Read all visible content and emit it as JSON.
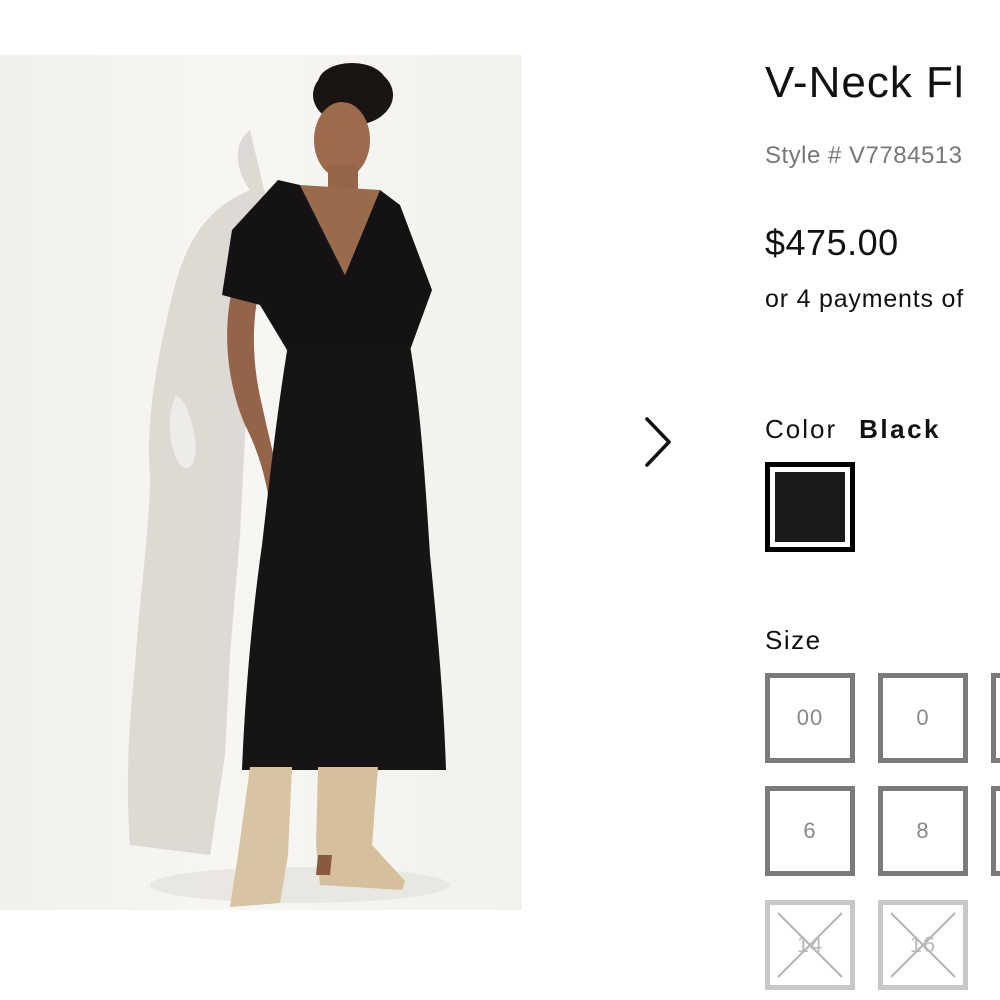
{
  "product": {
    "title": "V-Neck Fl",
    "style_number": "Style # V7784513",
    "price": "$475.00",
    "payments_text": "or 4 payments of"
  },
  "gallery": {
    "next_icon": "chevron-right-icon"
  },
  "color": {
    "label": "Color",
    "selected": "Black",
    "swatches": [
      {
        "name": "Black",
        "hex": "#1c1a19",
        "selected": true
      }
    ]
  },
  "size": {
    "label": "Size",
    "options": [
      {
        "label": "00",
        "available": true
      },
      {
        "label": "0",
        "available": true
      },
      {
        "label": "6",
        "available": true
      },
      {
        "label": "8",
        "available": true
      },
      {
        "label": "14",
        "available": false
      },
      {
        "label": "16",
        "available": false
      }
    ]
  }
}
